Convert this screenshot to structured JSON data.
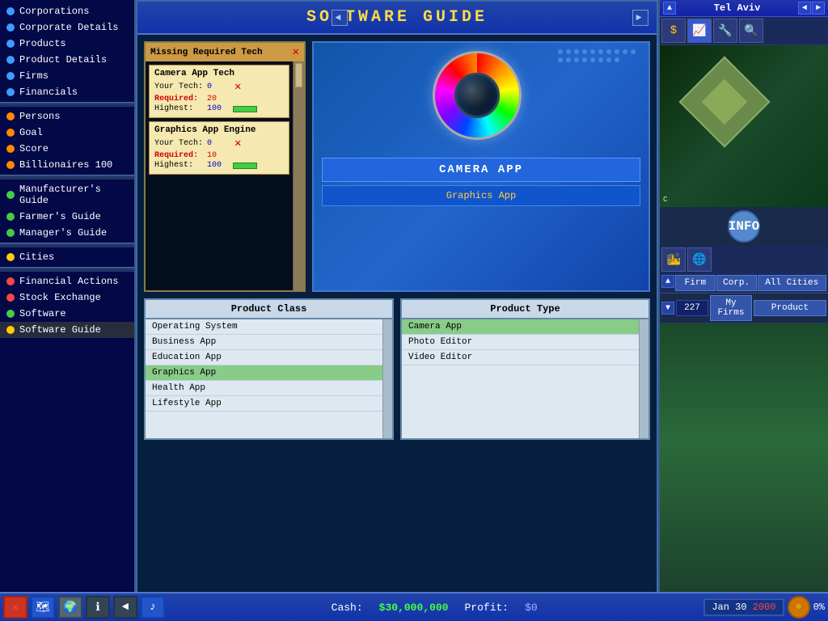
{
  "title": "SOFTWARE GUIDE",
  "sidebar": {
    "sections": [
      {
        "items": [
          {
            "id": "corporations",
            "label": "Corporations",
            "dot": "blue"
          },
          {
            "id": "corporate-details",
            "label": "Corporate Details",
            "dot": "blue"
          },
          {
            "id": "products",
            "label": "Products",
            "dot": "blue"
          },
          {
            "id": "product-details",
            "label": "Product Details",
            "dot": "blue"
          },
          {
            "id": "firms",
            "label": "Firms",
            "dot": "blue"
          },
          {
            "id": "financials",
            "label": "Financials",
            "dot": "blue"
          }
        ]
      },
      {
        "items": [
          {
            "id": "persons",
            "label": "Persons",
            "dot": "orange"
          },
          {
            "id": "goal",
            "label": "Goal",
            "dot": "orange"
          },
          {
            "id": "score",
            "label": "Score",
            "dot": "orange"
          },
          {
            "id": "billionaires",
            "label": "Billionaires 100",
            "dot": "orange"
          }
        ]
      },
      {
        "items": [
          {
            "id": "manufacturer-guide",
            "label": "Manufacturer's Guide",
            "dot": "green"
          },
          {
            "id": "farmer-guide",
            "label": "Farmer's Guide",
            "dot": "green"
          },
          {
            "id": "manager-guide",
            "label": "Manager's Guide",
            "dot": "green"
          }
        ]
      },
      {
        "items": [
          {
            "id": "cities",
            "label": "Cities",
            "dot": "yellow"
          }
        ]
      },
      {
        "items": [
          {
            "id": "financial-actions",
            "label": "Financial Actions",
            "dot": "red"
          },
          {
            "id": "stock-exchange",
            "label": "Stock Exchange",
            "dot": "red"
          },
          {
            "id": "software",
            "label": "Software",
            "dot": "green"
          },
          {
            "id": "software-guide",
            "label": "Software Guide",
            "dot": "yellow",
            "active": true
          }
        ]
      }
    ]
  },
  "tech_panel": {
    "title": "Missing Required Tech",
    "items": [
      {
        "name": "Camera App Tech",
        "your_tech_label": "Your Tech:",
        "your_tech_value": "0",
        "required_label": "Required:",
        "required_value": "20",
        "highest_label": "Highest:",
        "highest_value": "100"
      },
      {
        "name": "Graphics App Engine",
        "your_tech_label": "Your Tech:",
        "your_tech_value": "0",
        "required_label": "Required:",
        "required_value": "10",
        "highest_label": "Highest:",
        "highest_value": "100"
      }
    ]
  },
  "product": {
    "name": "CAMERA APP",
    "class": "Graphics App"
  },
  "nav_arrows": {
    "left": "◄",
    "right": "►"
  },
  "product_class_table": {
    "header": "Product Class",
    "rows": [
      {
        "label": "Operating System",
        "selected": false
      },
      {
        "label": "Business App",
        "selected": false
      },
      {
        "label": "Education App",
        "selected": false
      },
      {
        "label": "Graphics App",
        "selected": true
      },
      {
        "label": "Health App",
        "selected": false
      },
      {
        "label": "Lifestyle App",
        "selected": false
      }
    ]
  },
  "product_type_table": {
    "header": "Product Type",
    "rows": [
      {
        "label": "Camera App",
        "selected": true
      },
      {
        "label": "Photo Editor",
        "selected": false
      },
      {
        "label": "Video Editor",
        "selected": false
      }
    ]
  },
  "map": {
    "city": "Tel Aviv",
    "icons": [
      "$",
      "📈",
      "🔧"
    ],
    "info": "INFO"
  },
  "firm_controls": {
    "count": "227",
    "buttons": [
      "Firm",
      "Corp.",
      "All Cities",
      "My Firms",
      "Product"
    ]
  },
  "bottom_bar": {
    "cash_label": "Cash:",
    "cash_value": "$30,000,000",
    "profit_label": "Profit:",
    "profit_value": "$0",
    "date": "Jan 30",
    "year": "2000",
    "progress": "0%"
  }
}
